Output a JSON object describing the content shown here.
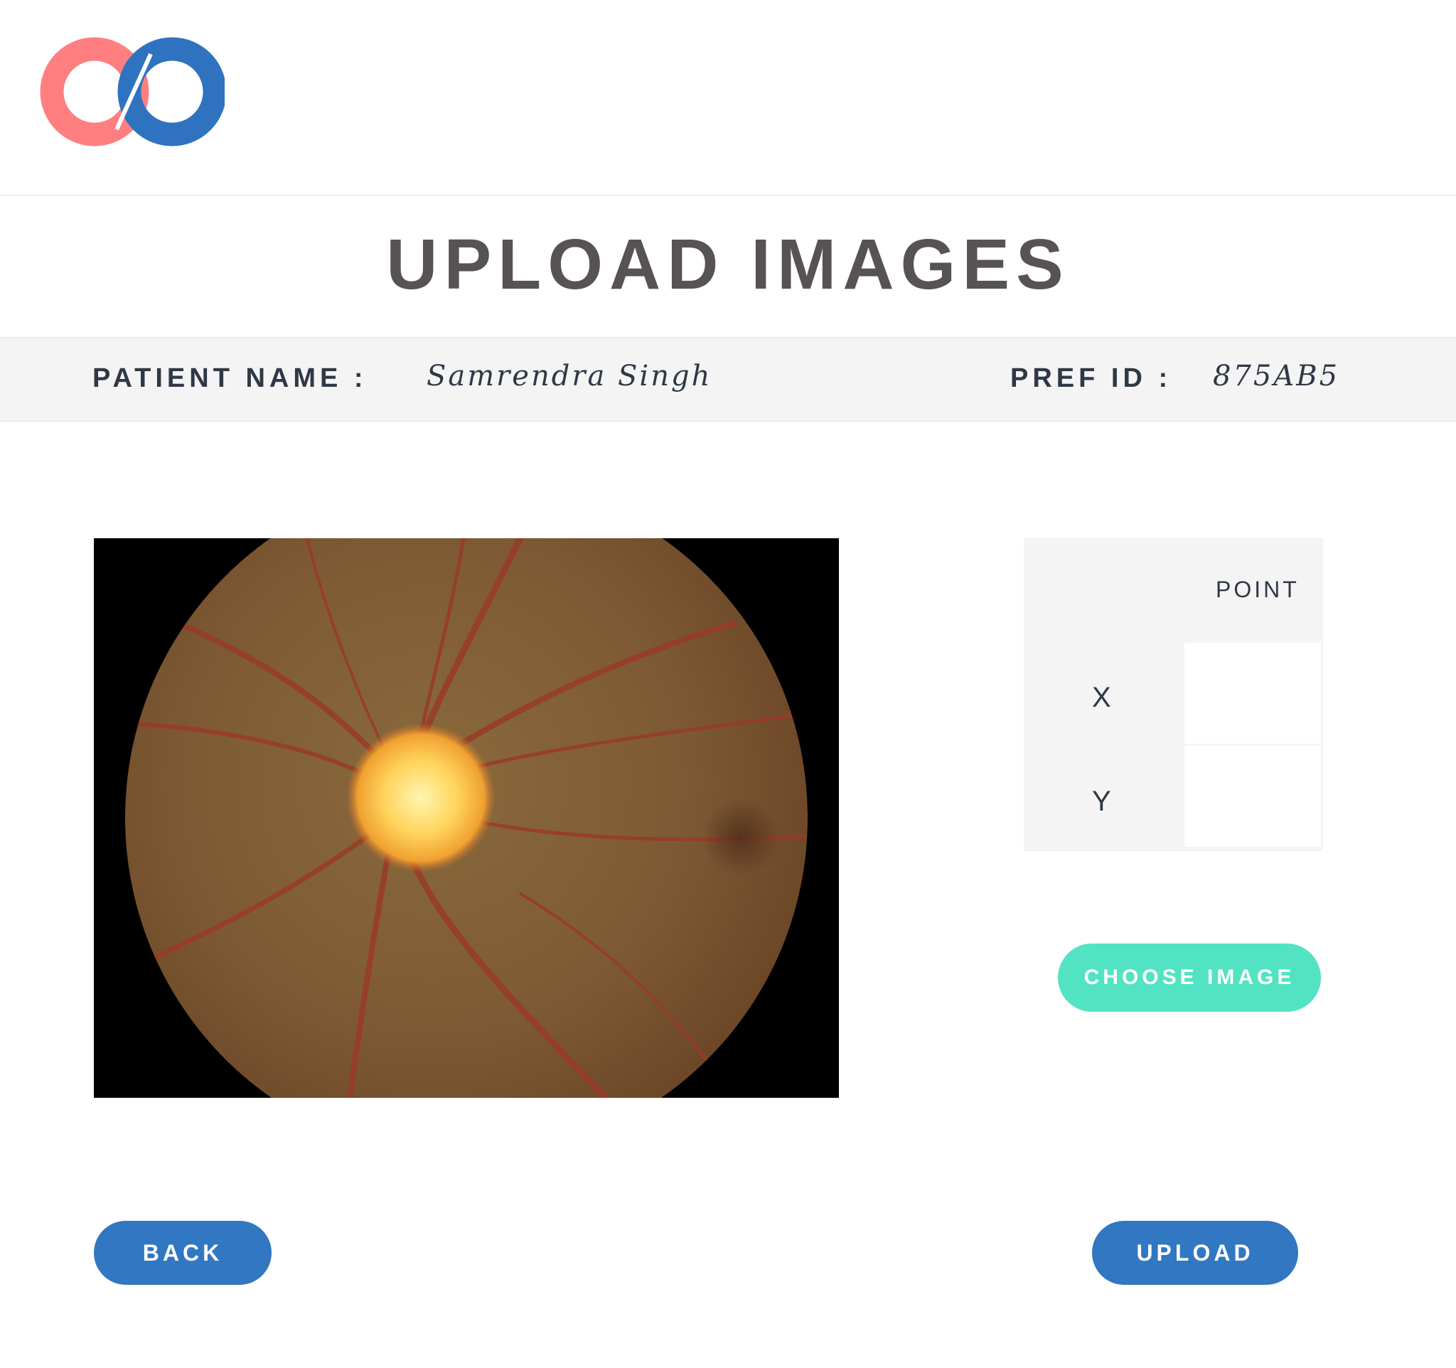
{
  "logo": {
    "icon": "infinity-logo",
    "colors": {
      "left": "#ff7f80",
      "right": "#2f73c0"
    }
  },
  "page_title": "UPLOAD IMAGES",
  "patient": {
    "name_label": "PATIENT NAME :",
    "name_value": "Samrendra Singh",
    "id_label": "PREF ID :",
    "id_value": "875AB5"
  },
  "image_panel": {
    "icon": "retina-fundus-image"
  },
  "coordinates": {
    "header": "POINT",
    "x_label": "X",
    "y_label": "Y",
    "x_value": "",
    "y_value": ""
  },
  "buttons": {
    "choose_image": "CHOOSE IMAGE",
    "back": "BACK",
    "upload": "UPLOAD"
  },
  "colors": {
    "accent_blue": "#3177c2",
    "accent_teal": "#52e3c2",
    "title_gray": "#575253",
    "text_dark": "#2f3846",
    "band_gray": "#f4f4f4"
  }
}
